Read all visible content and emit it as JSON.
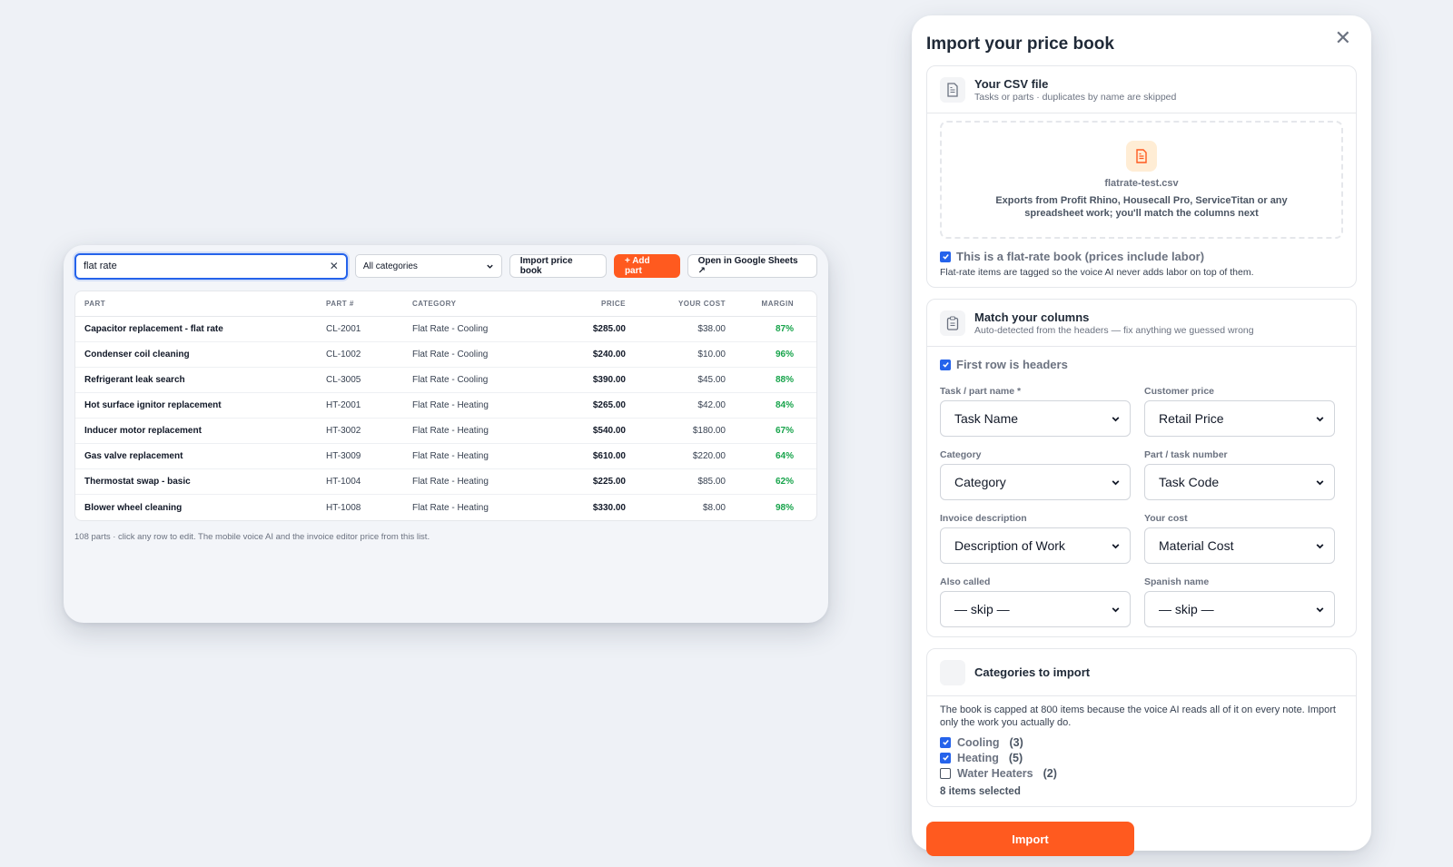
{
  "parts": {
    "search_value": "flat rate",
    "category_filter": "All categories",
    "import_label": "Import price book",
    "add_label": "+ Add part",
    "sheets_label": "Open in Google Sheets ↗",
    "columns": [
      "PART",
      "PART #",
      "CATEGORY",
      "PRICE",
      "YOUR COST",
      "MARGIN"
    ],
    "rows": [
      {
        "part": "Capacitor replacement - flat rate",
        "num": "CL-2001",
        "category": "Flat Rate - Cooling",
        "price": "$285.00",
        "cost": "$38.00",
        "margin": "87%"
      },
      {
        "part": "Condenser coil cleaning",
        "num": "CL-1002",
        "category": "Flat Rate - Cooling",
        "price": "$240.00",
        "cost": "$10.00",
        "margin": "96%"
      },
      {
        "part": "Refrigerant leak search",
        "num": "CL-3005",
        "category": "Flat Rate - Cooling",
        "price": "$390.00",
        "cost": "$45.00",
        "margin": "88%"
      },
      {
        "part": "Hot surface ignitor replacement",
        "num": "HT-2001",
        "category": "Flat Rate - Heating",
        "price": "$265.00",
        "cost": "$42.00",
        "margin": "84%"
      },
      {
        "part": "Inducer motor replacement",
        "num": "HT-3002",
        "category": "Flat Rate - Heating",
        "price": "$540.00",
        "cost": "$180.00",
        "margin": "67%"
      },
      {
        "part": "Gas valve replacement",
        "num": "HT-3009",
        "category": "Flat Rate - Heating",
        "price": "$610.00",
        "cost": "$220.00",
        "margin": "64%"
      },
      {
        "part": "Thermostat swap - basic",
        "num": "HT-1004",
        "category": "Flat Rate - Heating",
        "price": "$225.00",
        "cost": "$85.00",
        "margin": "62%"
      },
      {
        "part": "Blower wheel cleaning",
        "num": "HT-1008",
        "category": "Flat Rate - Heating",
        "price": "$330.00",
        "cost": "$8.00",
        "margin": "98%"
      }
    ],
    "footnote": "108 parts · click any row to edit. The mobile voice AI and the invoice editor price from this list."
  },
  "modal": {
    "title": "Import your price book",
    "csv": {
      "title": "Your CSV file",
      "subtitle": "Tasks or parts · duplicates by name are skipped",
      "filename": "flatrate-test.csv",
      "hint": "Exports from Profit Rhino, Housecall Pro, ServiceTitan or any spreadsheet work; you'll match the columns next",
      "flat_rate_label": "This is a flat-rate book (prices include labor)",
      "flat_rate_note": "Flat-rate items are tagged so the voice AI never adds labor on top of them."
    },
    "columns": {
      "title": "Match your columns",
      "subtitle": "Auto-detected from the headers — fix anything we guessed wrong",
      "headers_label": "First row is headers",
      "fields": [
        {
          "label": "Task / part name *",
          "value": "Task Name"
        },
        {
          "label": "Customer price",
          "value": "Retail Price"
        },
        {
          "label": "Category",
          "value": "Category"
        },
        {
          "label": "Part / task number",
          "value": "Task Code"
        },
        {
          "label": "Invoice description",
          "value": "Description of Work"
        },
        {
          "label": "Your cost",
          "value": "Material Cost"
        },
        {
          "label": "Also called",
          "value": "— skip —"
        },
        {
          "label": "Spanish name",
          "value": "— skip —"
        }
      ]
    },
    "categories": {
      "title": "Categories to import",
      "note": "The book is capped at 800 items because the voice AI reads all of it on every note. Import only the work you actually do.",
      "items": [
        {
          "name": "Cooling",
          "count": "(3)",
          "checked": true
        },
        {
          "name": "Heating",
          "count": "(5)",
          "checked": true
        },
        {
          "name": "Water Heaters",
          "count": "(2)",
          "checked": false
        }
      ],
      "selected": "8 items selected"
    },
    "import_label": "Import"
  },
  "colors": {
    "accent": "#ff5a1f",
    "focus": "#2563eb",
    "margin_green": "#16a34a"
  }
}
